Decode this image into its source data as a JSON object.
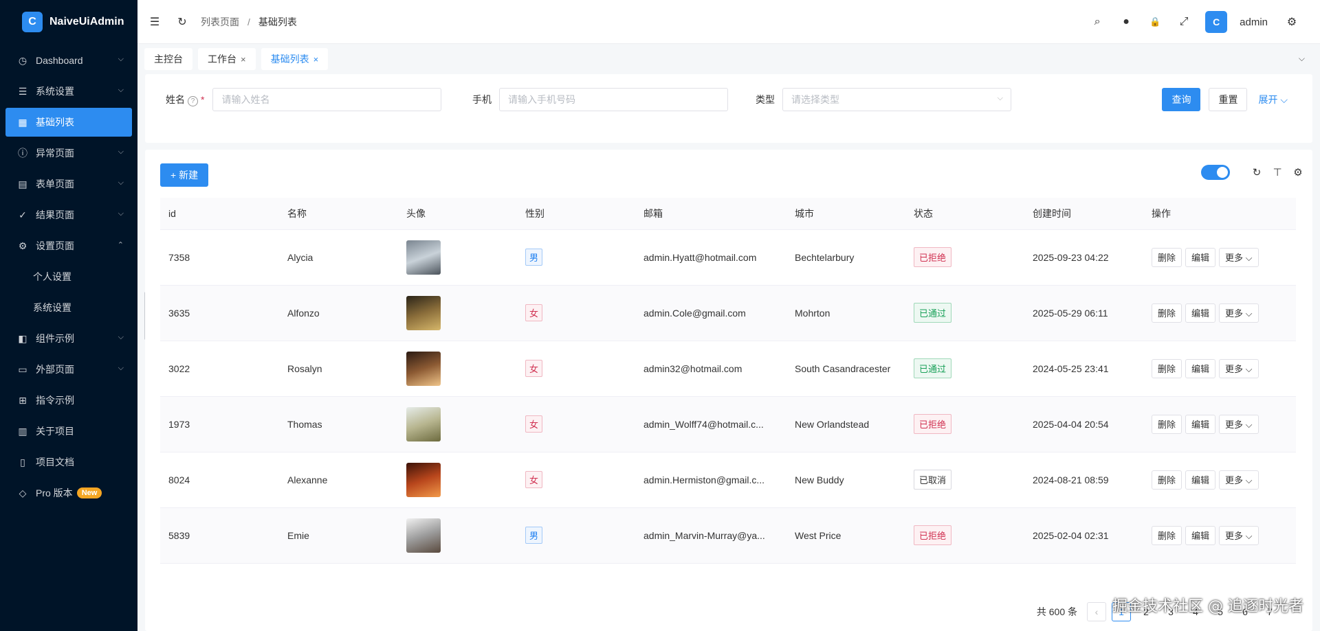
{
  "app": {
    "name": "NaiveUiAdmin",
    "logo_letter": "C"
  },
  "sidebar": {
    "items": [
      {
        "label": "Dashboard",
        "icon": "dashboard-icon",
        "glyph": "◷",
        "expandable": true,
        "chevron": "⌵"
      },
      {
        "label": "系统设置",
        "icon": "sliders-icon",
        "glyph": "☰",
        "expandable": true,
        "chevron": "⌵"
      },
      {
        "label": "基础列表",
        "icon": "table-icon",
        "glyph": "▦",
        "active": true
      },
      {
        "label": "异常页面",
        "icon": "alert-circle-icon",
        "glyph": "ⓘ",
        "expandable": true,
        "chevron": "⌵"
      },
      {
        "label": "表单页面",
        "icon": "form-icon",
        "glyph": "▤",
        "expandable": true,
        "chevron": "⌵"
      },
      {
        "label": "结果页面",
        "icon": "check-circle-icon",
        "glyph": "✓",
        "expandable": true,
        "chevron": "⌵"
      },
      {
        "label": "设置页面",
        "icon": "gear-icon",
        "glyph": "⚙",
        "expandable": true,
        "chevron": "⌃"
      },
      {
        "label": "个人设置",
        "sub": true
      },
      {
        "label": "系统设置",
        "sub": true
      },
      {
        "label": "组件示例",
        "icon": "component-icon",
        "glyph": "◧",
        "expandable": true,
        "chevron": "⌵"
      },
      {
        "label": "外部页面",
        "icon": "desktop-icon",
        "glyph": "▭",
        "expandable": true,
        "chevron": "⌵"
      },
      {
        "label": "指令示例",
        "icon": "directive-icon",
        "glyph": "⊞"
      },
      {
        "label": "关于项目",
        "icon": "project-icon",
        "glyph": "▥"
      },
      {
        "label": "项目文档",
        "icon": "document-icon",
        "glyph": "▯"
      },
      {
        "label": "Pro 版本",
        "icon": "diamond-icon",
        "glyph": "◇",
        "badge": "New"
      }
    ]
  },
  "header": {
    "collapse_glyph": "☰",
    "refresh_glyph": "↻",
    "breadcrumb": [
      "列表页面",
      "基础列表"
    ],
    "breadcrumb_sep": "/",
    "search_glyph": "⌕",
    "github_glyph": "●",
    "lock_glyph": "🔒",
    "fullscreen_glyph": "⤢",
    "settings_glyph": "⚙",
    "username": "admin",
    "avatar_letter": "C"
  },
  "tabs": {
    "items": [
      {
        "label": "主控台",
        "closable": false
      },
      {
        "label": "工作台",
        "closable": true
      },
      {
        "label": "基础列表",
        "closable": true,
        "active": true
      }
    ],
    "close_glyph": "×",
    "more_glyph": "⌵"
  },
  "search": {
    "name_label": "姓名",
    "name_help": "?",
    "name_required": "*",
    "name_placeholder": "请输入姓名",
    "phone_label": "手机",
    "phone_placeholder": "请输入手机号码",
    "type_label": "类型",
    "type_placeholder": "请选择类型",
    "select_arrow": "⌵",
    "query_label": "查询",
    "reset_label": "重置",
    "expand_label": "展开 ⌵"
  },
  "toolbar": {
    "new_label": "+ 新建",
    "density_on": true,
    "refresh_glyph": "↻",
    "column_height_glyph": "⊤",
    "settings_glyph": "⚙"
  },
  "table": {
    "columns": [
      "id",
      "名称",
      "头像",
      "性别",
      "邮箱",
      "城市",
      "状态",
      "创建时间",
      "操作"
    ],
    "rows": [
      {
        "id": "7358",
        "name": "Alycia",
        "avatar_colors": [
          "#7a8590",
          "#c9d2d9",
          "#4b535b"
        ],
        "gender": "男",
        "gender_type": "male",
        "email": "admin.Hyatt@hotmail.com",
        "city": "Bechtelarbury",
        "status": "已拒绝",
        "status_type": "reject",
        "created": "2025-09-23 04:22"
      },
      {
        "id": "3635",
        "name": "Alfonzo",
        "avatar_colors": [
          "#2a2418",
          "#8a6d3a",
          "#d6b76a"
        ],
        "gender": "女",
        "gender_type": "female",
        "email": "admin.Cole@gmail.com",
        "city": "Mohrton",
        "status": "已通过",
        "status_type": "pass",
        "created": "2025-05-29 06:11"
      },
      {
        "id": "3022",
        "name": "Rosalyn",
        "avatar_colors": [
          "#2b1a12",
          "#8c5a33",
          "#f0c58a"
        ],
        "gender": "女",
        "gender_type": "female",
        "email": "admin32@hotmail.com",
        "city": "South Casandracester",
        "status": "已通过",
        "status_type": "pass",
        "created": "2024-05-25 23:41"
      },
      {
        "id": "1973",
        "name": "Thomas",
        "avatar_colors": [
          "#e6ece9",
          "#b7b58f",
          "#6c6a3e"
        ],
        "gender": "女",
        "gender_type": "female",
        "email": "admin_Wolff74@hotmail.c...",
        "city": "New Orlandstead",
        "status": "已拒绝",
        "status_type": "reject",
        "created": "2025-04-04 20:54"
      },
      {
        "id": "8024",
        "name": "Alexanne",
        "avatar_colors": [
          "#3b1208",
          "#b8461c",
          "#f29a4a"
        ],
        "gender": "女",
        "gender_type": "female",
        "email": "admin.Hermiston@gmail.c...",
        "city": "New Buddy",
        "status": "已取消",
        "status_type": "cancel",
        "created": "2024-08-21 08:59"
      },
      {
        "id": "5839",
        "name": "Emie",
        "avatar_colors": [
          "#f1f1f1",
          "#9c9c9c",
          "#5a4a3e"
        ],
        "gender": "男",
        "gender_type": "male",
        "email": "admin_Marvin-Murray@ya...",
        "city": "West Price",
        "status": "已拒绝",
        "status_type": "reject",
        "created": "2025-02-04 02:31"
      }
    ],
    "actions": {
      "delete": "删除",
      "edit": "编辑",
      "more": "更多 ⌵"
    }
  },
  "pagination": {
    "total": "共 600 条",
    "prev_glyph": "‹",
    "pages": [
      "1",
      "2",
      "3",
      "4",
      "5",
      "6",
      "7"
    ],
    "current": "1"
  },
  "watermark": "掘金技术社区 @ 追逐时光者",
  "colors": {
    "primary": "#2d8cf0",
    "sidebar_bg": "#001428",
    "reject": "#d03050",
    "pass": "#18a058"
  }
}
